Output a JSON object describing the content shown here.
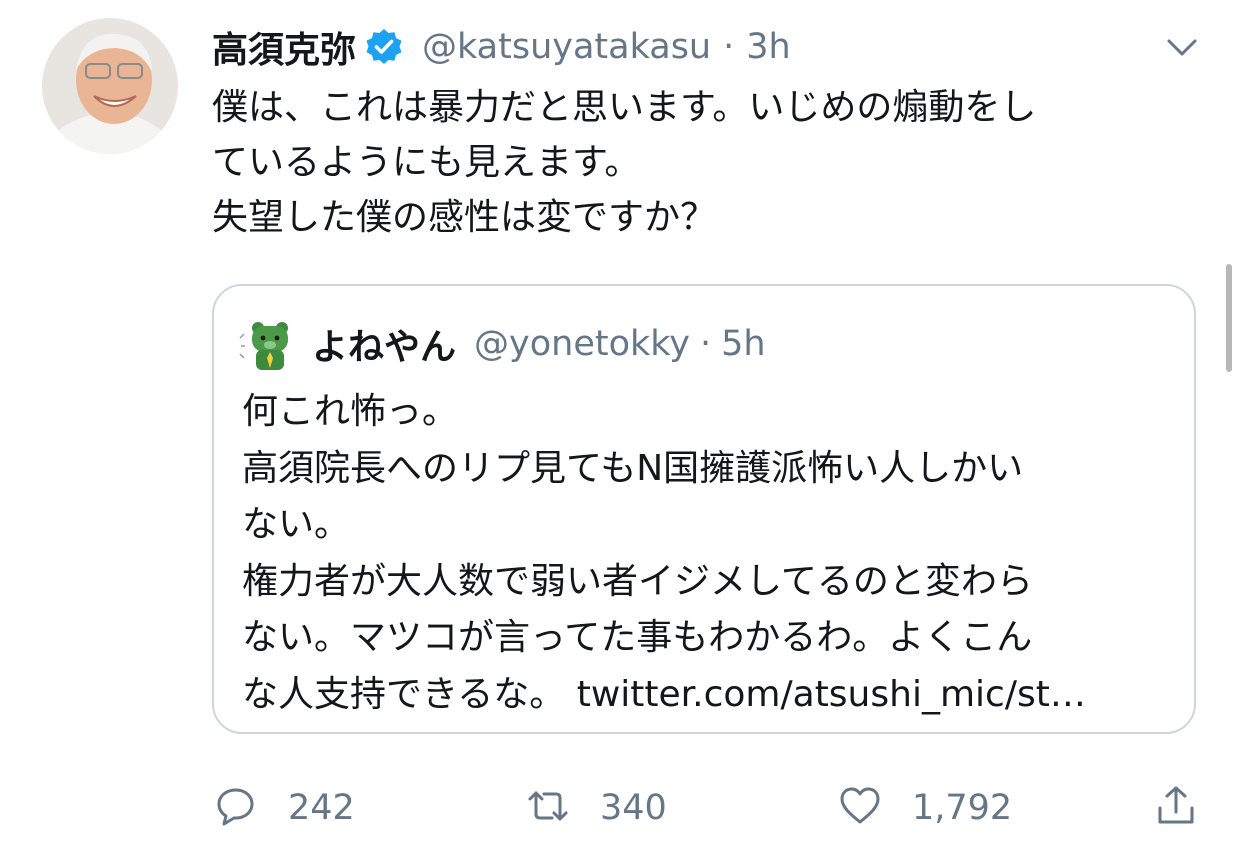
{
  "tweet": {
    "author_name": "高須克弥",
    "handle": "@katsuyatakasu",
    "separator": "·",
    "time": "3h",
    "text_lines": [
      "僕は、これは暴力だと思います。いじめの煽動をし",
      "ているようにも見えます。",
      "失望した僕の感性は変ですか？"
    ]
  },
  "quoted_tweet": {
    "author_name": "よねやん",
    "handle": "@yonetokky",
    "separator": "·",
    "time": "5h",
    "text_lines": [
      "何これ怖っ。",
      "高須院長へのリプ見てもN国擁護派怖い人しかい",
      "ない。",
      "権力者が大人数で弱い者イジメしてるのと変わら",
      "ない。マツコが言ってた事もわかるわ。よくこん"
    ],
    "last_line_text": "な人支持できるな。",
    "link_text": "twitter.com/atsushi_mic/st…"
  },
  "actions": {
    "reply_count": "242",
    "retweet_count": "340",
    "like_count": "1,792"
  },
  "icons": {
    "verified": "verified-badge-icon",
    "caret": "chevron-down-icon",
    "reply": "reply-icon",
    "retweet": "retweet-icon",
    "like": "heart-icon",
    "share": "share-icon"
  },
  "colors": {
    "text": "#14171a",
    "secondary": "#657786",
    "verified_blue": "#1da1f2",
    "border": "#ccd6dd"
  }
}
